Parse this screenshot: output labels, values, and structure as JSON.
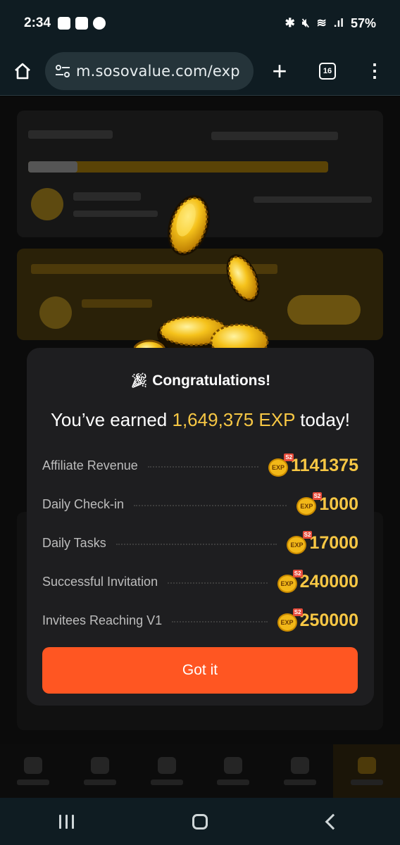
{
  "status_bar": {
    "time": "2:34",
    "battery": "57%"
  },
  "browser": {
    "url": "m.sosovalue.com/exp",
    "tab_count": "16"
  },
  "modal": {
    "title": "Congratulations!",
    "earned_prefix": "You’ve earned",
    "earned_amount": "1,649,375 EXP",
    "earned_suffix": "today!",
    "badge_text": "EXP",
    "badge_tag": "S2",
    "rows": [
      {
        "label": "Affiliate Revenue",
        "value": "1141375"
      },
      {
        "label": "Daily Check-in",
        "value": "1000"
      },
      {
        "label": "Daily Tasks",
        "value": "17000"
      },
      {
        "label": "Successful Invitation",
        "value": "240000"
      },
      {
        "label": "Invitees Reaching V1",
        "value": "250000"
      }
    ],
    "button_label": "Got it"
  },
  "colors": {
    "accent": "#f7c744",
    "button": "#ff5622",
    "modal_bg": "#1e1e20"
  },
  "icons": {
    "home": "home-icon",
    "url_tune": "tune-icon",
    "new_tab": "plus-icon",
    "tabs": "tabs-icon",
    "menu": "kebab-menu-icon",
    "party": "party-popper-icon"
  }
}
